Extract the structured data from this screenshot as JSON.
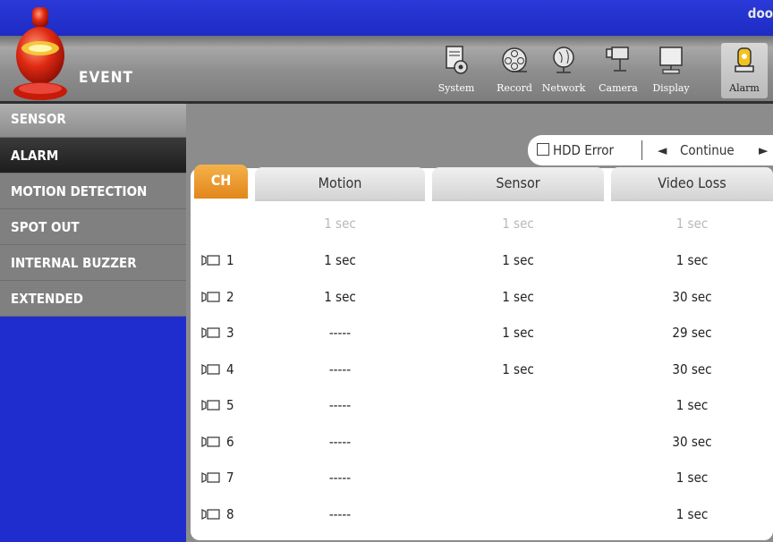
{
  "user": "doo",
  "header": {
    "title": "EVENT"
  },
  "menu": [
    {
      "label": "System",
      "icon": "system-icon"
    },
    {
      "label": "Record",
      "icon": "record-icon"
    },
    {
      "label": "Network",
      "icon": "network-icon"
    },
    {
      "label": "Camera",
      "icon": "camera-icon"
    },
    {
      "label": "Display",
      "icon": "display-icon"
    },
    {
      "label": "Alarm",
      "icon": "alarm-icon",
      "active": true
    }
  ],
  "sidebar": {
    "items": [
      {
        "label": "SENSOR"
      },
      {
        "label": "ALARM",
        "selected": true
      },
      {
        "label": "MOTION DETECTION"
      },
      {
        "label": "SPOT OUT"
      },
      {
        "label": "INTERNAL BUZZER"
      },
      {
        "label": "EXTENDED"
      }
    ]
  },
  "controls": {
    "hdd_error_label": "HDD Error",
    "hdd_error_checked": false,
    "mode_value": "Continue",
    "prev_icon": "◄",
    "next_icon": "►"
  },
  "table": {
    "headers": {
      "ch": "CH",
      "motion": "Motion",
      "sensor": "Sensor",
      "video_loss": "Video Loss"
    },
    "all_row": {
      "motion": "1 sec",
      "sensor": "1 sec",
      "video_loss": "1 sec"
    },
    "rows": [
      {
        "ch": "1",
        "motion": "1 sec",
        "sensor": "1 sec",
        "video_loss": "1 sec"
      },
      {
        "ch": "2",
        "motion": "1 sec",
        "sensor": "1 sec",
        "video_loss": "30 sec"
      },
      {
        "ch": "3",
        "motion": "-----",
        "sensor": "1 sec",
        "video_loss": "29 sec"
      },
      {
        "ch": "4",
        "motion": "-----",
        "sensor": "1 sec",
        "video_loss": "30 sec"
      },
      {
        "ch": "5",
        "motion": "-----",
        "sensor": "",
        "video_loss": "1 sec"
      },
      {
        "ch": "6",
        "motion": "-----",
        "sensor": "",
        "video_loss": "30 sec"
      },
      {
        "ch": "7",
        "motion": "-----",
        "sensor": "",
        "video_loss": "1 sec"
      },
      {
        "ch": "8",
        "motion": "-----",
        "sensor": "",
        "video_loss": "1 sec"
      }
    ]
  },
  "colors": {
    "accent": "#e2861a",
    "background": "#1f2dcf",
    "panel": "#8c8c8c"
  }
}
